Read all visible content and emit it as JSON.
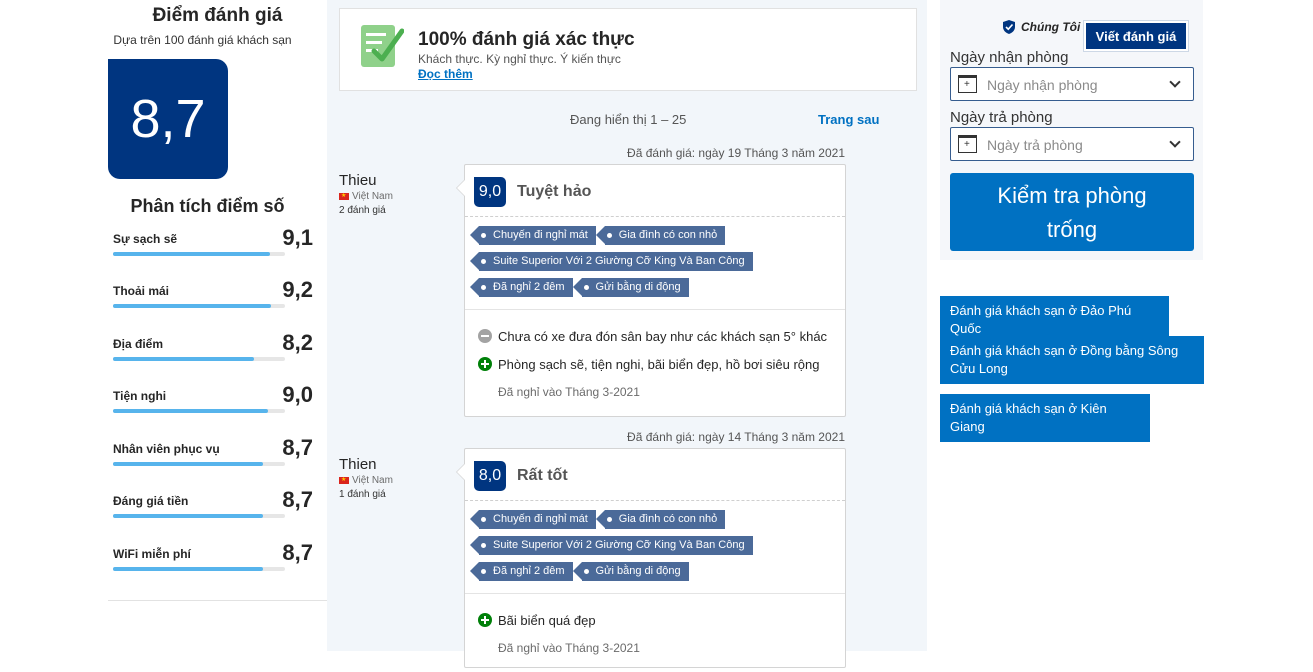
{
  "summary": {
    "title": "Điểm đánh giá",
    "subtitle": "Dựa trên 100 đánh giá khách sạn",
    "overall_score": "8,7",
    "breakdown_title": "Phân tích điểm số",
    "categories": [
      {
        "label": "Sự sạch sẽ",
        "score": "9,1",
        "fill": 0.91
      },
      {
        "label": "Thoải mái",
        "score": "9,2",
        "fill": 0.92
      },
      {
        "label": "Địa điểm",
        "score": "8,2",
        "fill": 0.82
      },
      {
        "label": "Tiện nghi",
        "score": "9,0",
        "fill": 0.9
      },
      {
        "label": "Nhân viên phục vụ",
        "score": "8,7",
        "fill": 0.87
      },
      {
        "label": "Đáng giá tiền",
        "score": "8,7",
        "fill": 0.87
      },
      {
        "label": "WiFi miễn phí",
        "score": "8,7",
        "fill": 0.87
      }
    ]
  },
  "verified": {
    "title": "100% đánh giá xác thực",
    "description": "Khách thực. Kỳ nghỉ thực. Ý kiến thực",
    "link": "Đọc thêm"
  },
  "pager": {
    "showing": "Đang hiển thị 1 – 25",
    "next": "Trang sau"
  },
  "reviews": [
    {
      "date": "Đã đánh giá: ngày 19 Tháng 3 năm 2021",
      "name": "Thieu",
      "country": "Việt Nam",
      "count": "2 đánh giá",
      "score": "9,0",
      "title": "Tuyệt hảo",
      "tags": [
        [
          "Chuyến đi nghỉ mát",
          "Gia đình có con nhỏ"
        ],
        [
          "Suite Superior Với 2 Giường Cỡ King Và Ban Công"
        ],
        [
          "Đã nghỉ 2 đêm",
          "Gửi bằng di động"
        ]
      ],
      "negative": "Chưa có xe đưa đón sân bay như các khách sạn 5° khác",
      "positive": "Phòng sạch sẽ, tiện nghi, bãi biển đẹp, hồ bơi siêu rộng",
      "stayed": "Đã nghỉ vào Tháng 3-2021"
    },
    {
      "date": "Đã đánh giá: ngày 14 Tháng 3 năm 2021",
      "name": "Thien",
      "country": "Việt Nam",
      "count": "1 đánh giá",
      "score": "8,0",
      "title": "Rất tốt",
      "tags": [
        [
          "Chuyến đi nghỉ mát",
          "Gia đình có con nhỏ"
        ],
        [
          "Suite Superior Với 2 Giường Cỡ King Và Ban Công"
        ],
        [
          "Đã nghỉ 2 đêm",
          "Gửi bằng di động"
        ]
      ],
      "positive": "Bãi biển quá đẹp",
      "stayed": "Đã nghỉ vào Tháng 3-2021"
    }
  ],
  "booking": {
    "we_label": "Chúng Tôi",
    "write_review": "Viết đánh giá",
    "checkin_label": "Ngày nhận phòng",
    "checkin_placeholder": "Ngày nhận phòng",
    "checkout_label": "Ngày trả phòng",
    "checkout_placeholder": "Ngày trả phòng",
    "check_availability_line1": "Kiểm tra phòng",
    "check_availability_line2": "trống"
  },
  "related_links": [
    "Đánh giá khách sạn ở Đảo Phú Quốc",
    "Đánh giá khách sạn ở Đồng bằng Sông Cửu Long",
    "Đánh giá khách sạn ở Kiên Giang"
  ],
  "colors": {
    "brand_dark": "#003580",
    "brand_blue": "#0071c2",
    "bar": "#57b4ec",
    "positive": "#008009"
  }
}
